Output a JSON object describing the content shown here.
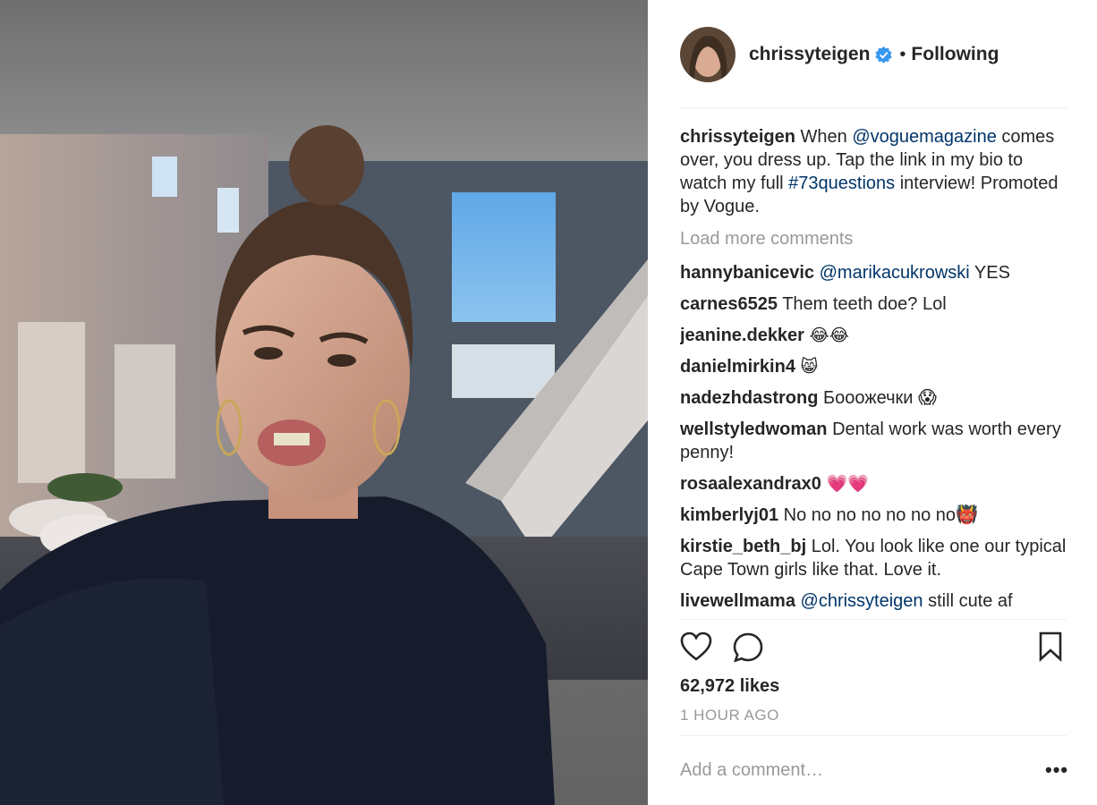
{
  "post": {
    "username": "chrissyteigen",
    "dot": "•",
    "follow_status": "Following",
    "caption_prefix": "When ",
    "caption_mention": "@voguemagazine",
    "caption_mid": " comes over, you dress up. Tap the link in my bio to watch my full ",
    "caption_hashtag": "#73questions",
    "caption_suffix": " interview! Promoted by Vogue.",
    "load_more": "Load more comments",
    "likes": "62,972 likes",
    "time": "1 HOUR AGO",
    "add_comment_placeholder": "Add a comment…",
    "more_options": "•••"
  },
  "comments": [
    {
      "user": "hannybanicevic",
      "mention": "@marikacukrowski",
      "text": " YES"
    },
    {
      "user": "carnes6525",
      "text": "Them teeth doe? Lol"
    },
    {
      "user": "jeanine.dekker",
      "text": "😂😂"
    },
    {
      "user": "danielmirkin4",
      "text": "😸"
    },
    {
      "user": "nadezhdastrong",
      "text": "Бооожечки 😱"
    },
    {
      "user": "wellstyledwoman",
      "text": "Dental work was worth every penny!"
    },
    {
      "user": "rosaalexandrax0",
      "text": "💗💗"
    },
    {
      "user": "kimberlyj01",
      "text": "No no no no no no no👹"
    },
    {
      "user": "kirstie_beth_bj",
      "text": "Lol. You look like one our typical Cape Town girls like that. Love it."
    },
    {
      "user": "livewellmama",
      "mention": "@chrissyteigen",
      "text": " still cute af"
    }
  ],
  "icons": {
    "like": "heart-icon",
    "comment": "comment-bubble-icon",
    "save": "bookmark-icon",
    "verified": "verified-badge-icon"
  },
  "colors": {
    "link": "#003569",
    "verified": "#3897f0",
    "muted": "#999999",
    "text": "#262626"
  }
}
